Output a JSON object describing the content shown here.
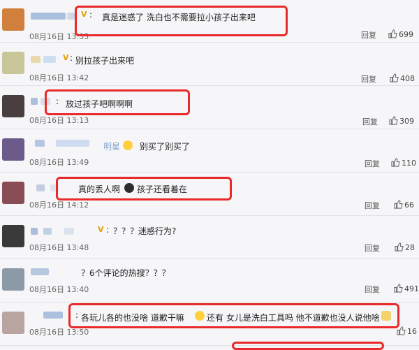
{
  "reply_label": "回复",
  "comments": [
    {
      "text": "真是迷惑了 洗白也不需要拉小孩子出来吧",
      "time": "08月16日 13:35",
      "likes": "699",
      "badge": "V",
      "colon": ":",
      "avatar_color": "#d0803c",
      "blur_colors": [
        "#9bb6d8",
        "#c7d3e6"
      ],
      "has_reply": true
    },
    {
      "text": "别拉孩子出来吧",
      "time": "08月16日 13:42",
      "likes": "408",
      "badge": "V",
      "colon": ":",
      "avatar_color": "#c9c79a",
      "blur_colors": [
        "#e8d3a0",
        "#c6d9ef"
      ],
      "has_reply": true
    },
    {
      "text": "放过孩子吧啊啊啊",
      "time": "08月16日 13:13",
      "likes": "309",
      "badge": "",
      "colon": ":",
      "avatar_color": "#4a3f3f",
      "blur_colors": [
        "#9fb5d6",
        "#d4dbe7"
      ],
      "has_reply": true
    },
    {
      "text": "别买了别买了",
      "time": "08月16日 13:49",
      "likes": "110",
      "badge": "",
      "colon": "",
      "prefix": "明星",
      "avatar_color": "#6b5a8a",
      "blur_colors": [
        "#a9bde0",
        "#c7d6ee"
      ],
      "has_reply": true
    },
    {
      "text_a": "真的丢人啊",
      "text_b": "孩子还看着在",
      "time": "08月16日 14:12",
      "likes": "66",
      "badge": "",
      "colon": "",
      "avatar_color": "#8a4d55",
      "blur_colors": [
        "#b8c6dd",
        "#d8dfea"
      ],
      "has_reply": true
    },
    {
      "text": "？？？迷惑行为?",
      "time": "08月16日 13:48",
      "likes": "28",
      "badge": "V",
      "colon": ":",
      "avatar_color": "#3a3a3a",
      "blur_colors": [
        "#9db3d4",
        "#b9c9e0"
      ],
      "has_reply": true
    },
    {
      "text": "？6个评论的热搜？？？",
      "time": "08月16日 13:40",
      "likes": "491",
      "badge": "",
      "colon": "",
      "avatar_color": "#8c9aa8",
      "blur_colors": [
        "#aabfdc",
        "#d4dbe7"
      ],
      "has_reply": true
    },
    {
      "text_a": "各玩儿各的也没啥 道歉干嘛",
      "text_b": "还有 女儿是洗白工具吗 他不道歉也没人说他啥",
      "time": "08月16日 13:50",
      "likes": "16",
      "badge": "",
      "colon": ":",
      "avatar_color": "#b9a4a0",
      "blur_colors": [
        "#9fb7d9",
        "#c9d4e6"
      ],
      "has_reply": false
    }
  ]
}
